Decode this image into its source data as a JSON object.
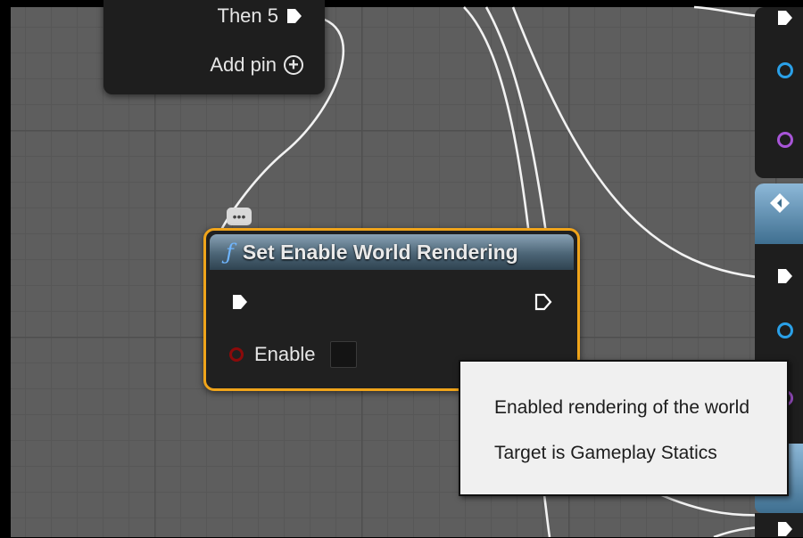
{
  "sequence_node": {
    "then_pin_label": "Then 5",
    "add_pin_label": "Add pin"
  },
  "function_node": {
    "icon": "function-icon",
    "icon_glyph": "ƒ",
    "title": "Set Enable World Rendering",
    "enable_label": "Enable",
    "enable_checked": false
  },
  "comment_bubble": {
    "glyph": "•••"
  },
  "tooltip": {
    "description": "Enabled rendering of the world",
    "target": "Target is Gameplay Statics"
  },
  "colors": {
    "selection_outline": "#f0a41a",
    "exec_pin": "#ffffff",
    "bool_pin": "#8c0a0a",
    "object_pin": "#2aa0e8",
    "struct_pin": "#a855d8",
    "header": "#4c6576",
    "grid": "#5e5e5e"
  }
}
